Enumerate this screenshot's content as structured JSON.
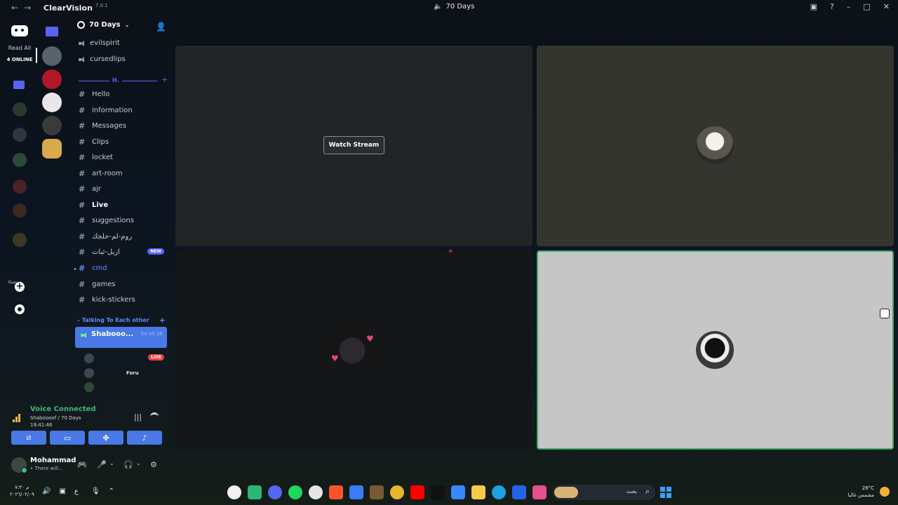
{
  "window": {
    "brand": "ClearVision",
    "version": "7.0.1",
    "title": "70 Days",
    "nav_back": "←",
    "nav_forward": "→",
    "inbox_icon": "inbox-icon",
    "help_icon": "help-icon"
  },
  "rail": {
    "read_all": "Read All",
    "online": "4 ONLINE",
    "server_text": "ﻊﻤﺘﺠﻤﻟﺍ"
  },
  "server": {
    "name": "70 Days"
  },
  "voice_channels_top": [
    {
      "name": "evilspirit"
    },
    {
      "name": "cursedlips"
    }
  ],
  "category_h": {
    "label": "H."
  },
  "channels": [
    {
      "name": "Hello"
    },
    {
      "name": "information"
    },
    {
      "name": "Messages"
    },
    {
      "name": "Clips"
    },
    {
      "name": "locket"
    },
    {
      "name": "art-room"
    },
    {
      "name": "ajr"
    },
    {
      "name": "Live"
    },
    {
      "name": "suggestions"
    },
    {
      "name": "روم-لم-حلجك"
    },
    {
      "name": "ازبل-ثبات",
      "badge": "NEW"
    },
    {
      "name": "cmd"
    },
    {
      "name": "games"
    },
    {
      "name": "kick-stickers"
    }
  ],
  "category2": {
    "label": "Talking To Each other"
  },
  "active_voice": {
    "name": "Shabooo...",
    "time": "34:45:26"
  },
  "voice_members": [
    {
      "name": "",
      "live": "LIVE"
    },
    {
      "name": "Foru"
    },
    {
      "name": ""
    }
  ],
  "voice_panel": {
    "title": "Voice Connected",
    "sub": "Shaboooof / 70 Days",
    "time": "19:41:46"
  },
  "user": {
    "name": "Mohammad",
    "status": "• There will..."
  },
  "stage": {
    "watch_label": "Watch Stream"
  },
  "taskbar": {
    "clock_time": "م ٧:٣٠",
    "clock_date": "٢٠٢٦/٠٢/٠٩",
    "lang": "ع",
    "search_placeholder": "بحث",
    "temp": "28°C",
    "weather": "مشمس غالبا"
  },
  "colors": {
    "accent": "#5865f2",
    "active_blue": "#4a78e6",
    "voice_green": "#43b581",
    "live_red": "#ed4245",
    "speaking_border": "#3fa85f"
  }
}
